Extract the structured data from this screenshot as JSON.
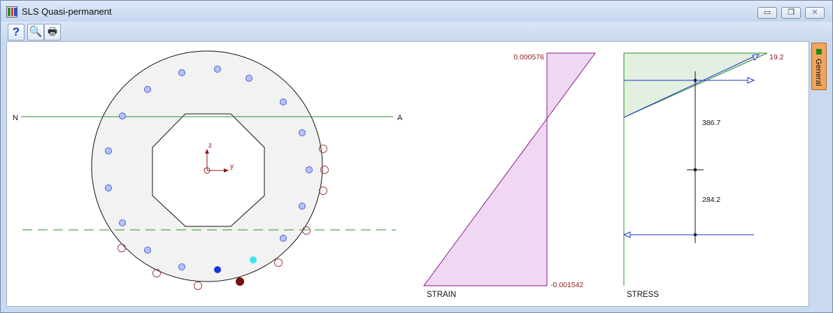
{
  "window": {
    "title": "SLS Quasi-permanent"
  },
  "controls": {
    "minimize": "▭",
    "restore": "❐",
    "close": "✕"
  },
  "toolbar": {
    "items": [
      {
        "icon": "help-icon",
        "glyph": "?"
      },
      {
        "icon": "print-preview-icon",
        "glyph": "🔍"
      },
      {
        "icon": "printer-icon",
        "glyph": "🖶"
      }
    ]
  },
  "section": {
    "na_left": "N",
    "na_right": "A",
    "axis_z": "z",
    "axis_y": "y"
  },
  "strain": {
    "label": "STRAIN",
    "top_value": "0.000576",
    "bottom_value": "-0.001542"
  },
  "stress": {
    "label": "STRESS",
    "top_value": "19.2",
    "lever_upper": "386.7",
    "lever_lower": "284.2"
  },
  "side_tab": {
    "label": "General"
  },
  "colors": {
    "section_fill": "#f2f2f2",
    "rebar_blue": "#5a73e8",
    "rebar_red": "#a04040",
    "neutral_axis": "#2c8f2c",
    "strain_fill": "#f0d8f3",
    "strain_line": "#8b1a8b",
    "stress_fill": "#e3efe0",
    "force_arrow": "#1c34c8",
    "value_text": "#8b1a1a"
  }
}
